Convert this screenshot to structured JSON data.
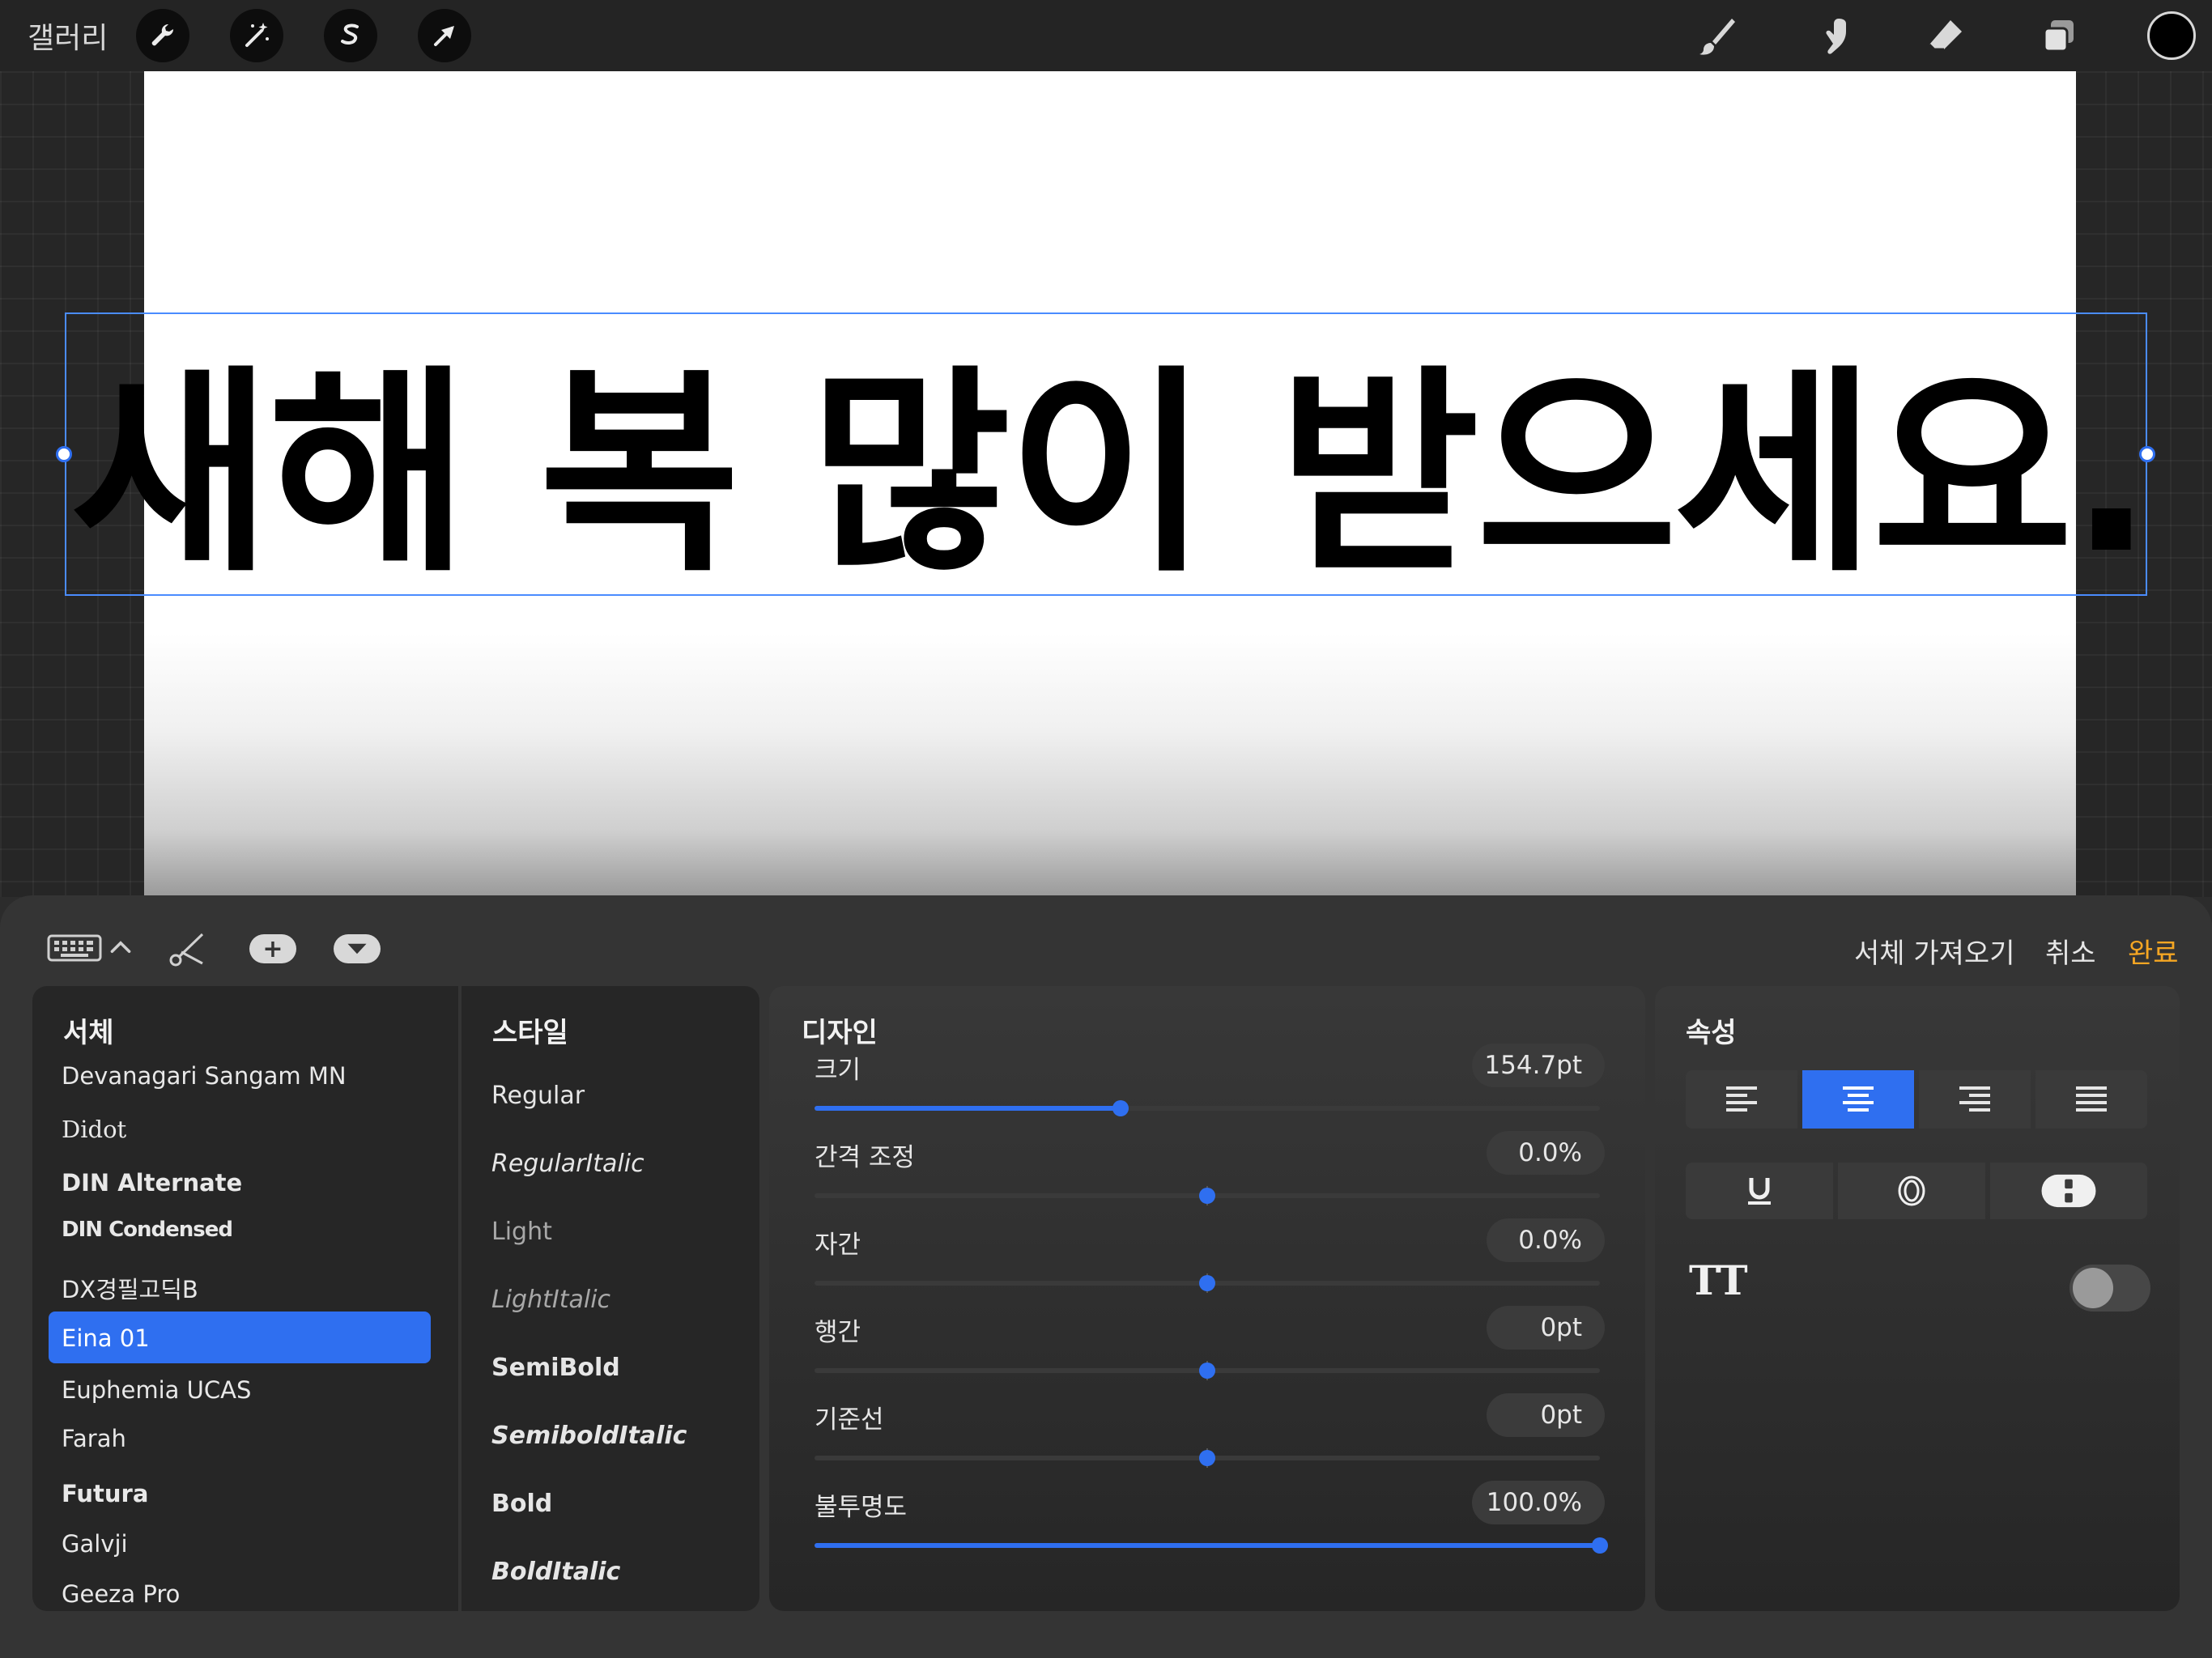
{
  "topbar": {
    "gallery_label": "갤러리",
    "left_tools": [
      "wrench-icon",
      "magic-wand-icon",
      "selection-icon",
      "transform-arrow-icon"
    ],
    "right_tools": [
      "brush-icon",
      "smudge-icon",
      "eraser-icon",
      "layers-icon"
    ],
    "current_color": "#000000"
  },
  "canvas": {
    "text": "새해 복 많이 받으세요."
  },
  "panel": {
    "toolbar": {
      "keyboard_chevron": "^",
      "import_font_label": "서체 가져오기",
      "cancel_label": "취소",
      "done_label": "완료",
      "done_color": "#f5a623"
    },
    "fonts": {
      "title": "서체",
      "items": [
        "Devanagari Sangam MN",
        "Didot",
        "DIN Alternate",
        "DIN Condensed",
        "DX경필고딕B",
        "Eina 01",
        "Euphemia  UCAS",
        "Farah",
        "Futura",
        "Galvji",
        "Geeza Pro"
      ],
      "selected": "Eina 01"
    },
    "styles": {
      "title": "스타일",
      "items": [
        "Regular",
        "RegularItalic",
        "Light",
        "LightItalic",
        "SemiBold",
        "SemiboldItalic",
        "Bold",
        "BoldItalic"
      ]
    },
    "design": {
      "title": "디자인",
      "sliders": [
        {
          "label": "크기",
          "value": "154.7pt",
          "fraction": 0.39
        },
        {
          "label": "간격 조정",
          "value": "0.0%",
          "fraction": 0.5
        },
        {
          "label": "자간",
          "value": "0.0%",
          "fraction": 0.5
        },
        {
          "label": "행간",
          "value": "0pt",
          "fraction": 0.5
        },
        {
          "label": "기준선",
          "value": "0pt",
          "fraction": 0.5
        },
        {
          "label": "불투명도",
          "value": "100.0%",
          "fraction": 1.0
        }
      ]
    },
    "attributes": {
      "title": "속성",
      "alignments": [
        "align-left-icon",
        "align-center-icon",
        "align-right-icon",
        "align-justify-icon"
      ],
      "active_alignment": "align-center-icon",
      "decorations": [
        "underline-icon",
        "outline-icon",
        "vertical-text-icon"
      ],
      "all_caps_label": "TT",
      "all_caps_enabled": false
    }
  }
}
